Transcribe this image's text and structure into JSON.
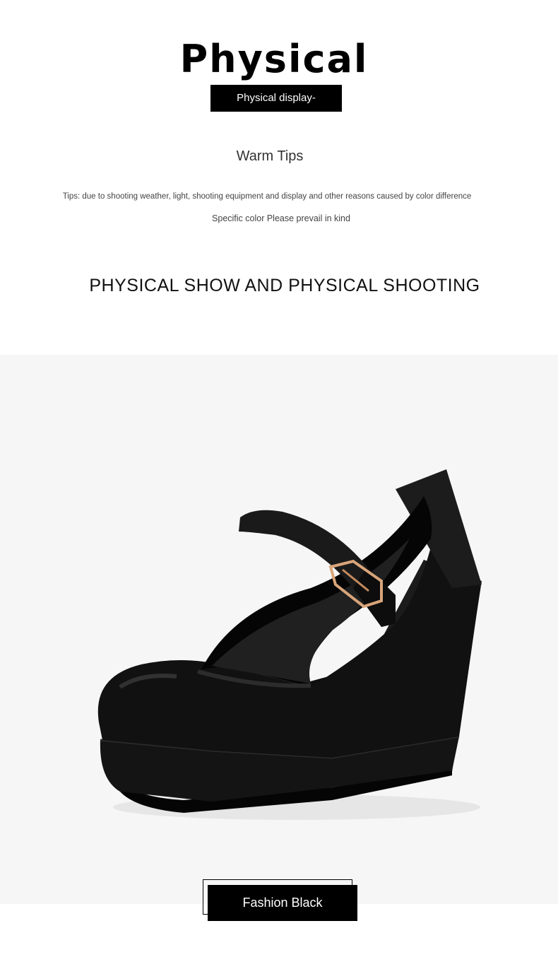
{
  "header": {
    "title": "Physical",
    "subtitle": "Physical display-"
  },
  "tips": {
    "heading": "Warm Tips",
    "line1": "Tips: due to shooting weather, light, shooting equipment and display and other reasons caused by color difference",
    "line2": "Specific color Please prevail in kind"
  },
  "section": {
    "heading": "PHYSICAL SHOW AND PHYSICAL SHOOTING"
  },
  "product": {
    "image_name": "black-wedge-mary-jane-shoe",
    "color_label": "Fashion Black",
    "photo_background": "#f6f6f6",
    "shoe_color": "#151515",
    "buckle_color": "#d9a57a"
  }
}
